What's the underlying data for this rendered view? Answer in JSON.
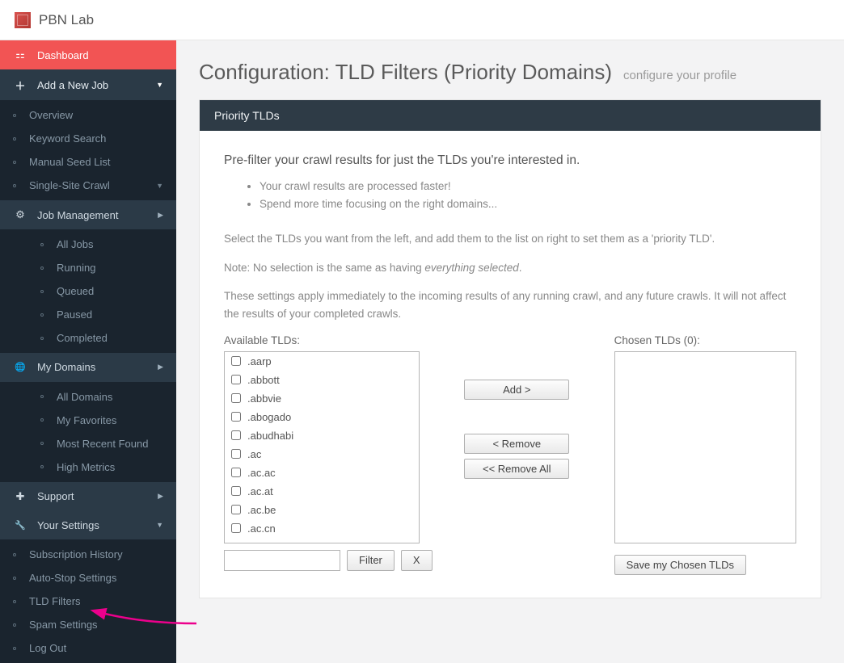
{
  "brand": "PBN Lab",
  "sidebar": {
    "dashboard": "Dashboard",
    "addJob": "Add a New Job",
    "addJobSubs": [
      "Overview",
      "Keyword Search",
      "Manual Seed List",
      "Single-Site Crawl"
    ],
    "jobMgmt": "Job Management",
    "jobSubs": [
      "All Jobs",
      "Running",
      "Queued",
      "Paused",
      "Completed"
    ],
    "myDomains": "My Domains",
    "domainSubs": [
      "All Domains",
      "My Favorites",
      "Most Recent Found",
      "High Metrics"
    ],
    "support": "Support",
    "yourSettings": "Your Settings",
    "settingsSubs": [
      "Subscription History",
      "Auto-Stop Settings",
      "TLD Filters",
      "Spam Settings",
      "Log Out"
    ]
  },
  "page": {
    "title": "Configuration: TLD Filters (Priority Domains)",
    "subtitle": "configure your profile",
    "panelTitle": "Priority TLDs",
    "introHeading": "Pre-filter your crawl results for just the TLDs you're interested in.",
    "introBullets": [
      "Your crawl results are processed faster!",
      "Spend more time focusing on the right domains..."
    ],
    "para1a": "Select the TLDs you want from the left, and add them to the list on right to set them as a 'priority TLD'.",
    "para2a": "Note: No selection is the same as having ",
    "para2b": "everything selected",
    "para2c": ".",
    "para3": "These settings apply immediately to the incoming results of any running crawl, and any future crawls. It will not affect the results of your completed crawls.",
    "availableLabel": "Available TLDs:",
    "chosenLabel": "Chosen TLDs (0):",
    "tlds": [
      ".aarp",
      ".abbott",
      ".abbvie",
      ".abogado",
      ".abudhabi",
      ".ac",
      ".ac.ac",
      ".ac.at",
      ".ac.be",
      ".ac.cn"
    ],
    "addBtn": "Add  >",
    "removeBtn": "<  Remove",
    "removeAllBtn": "<<  Remove All",
    "filterBtn": "Filter",
    "clearBtn": "X",
    "saveBtn": "Save my Chosen TLDs"
  }
}
